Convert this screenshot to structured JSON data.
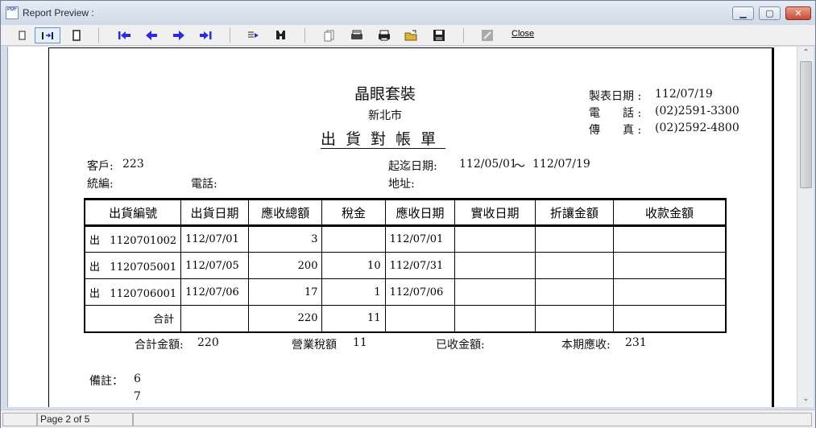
{
  "window": {
    "title": "Report Preview :",
    "app_icon_text": "PDF"
  },
  "toolbar": {
    "close_label": "Close"
  },
  "report": {
    "company": "晶眼套裝",
    "city": "新北市",
    "title": "出貨對帳單",
    "print_date_label": "製表日期 :",
    "print_date": "112/07/19",
    "phone_label": "電　　話 :",
    "phone": "(02)2591-3300",
    "fax_label": "傳　　真 :",
    "fax": "(02)2592-4800",
    "customer_label": "客戶:",
    "customer": "223",
    "tax_id_label": "統編:",
    "tel_label": "電話:",
    "period_label": "起迄日期:",
    "period_start": "112/05/01",
    "period_sep": "～",
    "period_end": "112/07/19",
    "address_label": "地址:",
    "columns": [
      "出貨編號",
      "出貨日期",
      "應收總額",
      "稅金",
      "應收日期",
      "實收日期",
      "折讓金額",
      "收款金額"
    ],
    "rows": [
      {
        "prefix": "出",
        "no": "1120701002",
        "date": "112/07/01",
        "total": "3",
        "tax": "",
        "due": "112/07/01",
        "received": "",
        "discount": "",
        "collected": ""
      },
      {
        "prefix": "出",
        "no": "1120705001",
        "date": "112/07/05",
        "total": "200",
        "tax": "10",
        "due": "112/07/31",
        "received": "",
        "discount": "",
        "collected": ""
      },
      {
        "prefix": "出",
        "no": "1120706001",
        "date": "112/07/06",
        "total": "17",
        "tax": "1",
        "due": "112/07/06",
        "received": "",
        "discount": "",
        "collected": ""
      }
    ],
    "subtotal_label": "合計",
    "subtotal_total": "220",
    "subtotal_tax": "11",
    "sum_amount_label": "合計金額:",
    "sum_amount": "220",
    "sales_tax_label": "營業稅額",
    "sales_tax": "11",
    "received_label": "已收金額:",
    "period_due_label": "本期應收:",
    "period_due": "231",
    "remarks_label": "備註：",
    "remarks": [
      "6",
      "7"
    ]
  },
  "status": {
    "page_text": "Page 2 of 5"
  },
  "colors": {
    "nav_arrow": "#2c2cd8",
    "titlebar": "#dce4ef",
    "close_button": "#c74a35"
  },
  "icons": [
    "single-page-icon",
    "two-page-icon",
    "full-page-icon",
    "first-page-icon",
    "prev-page-icon",
    "next-page-icon",
    "last-page-icon",
    "goto-page-icon",
    "find-icon",
    "copy-icon",
    "print-setup-icon",
    "print-icon",
    "open-icon",
    "save-icon",
    "export-icon"
  ]
}
